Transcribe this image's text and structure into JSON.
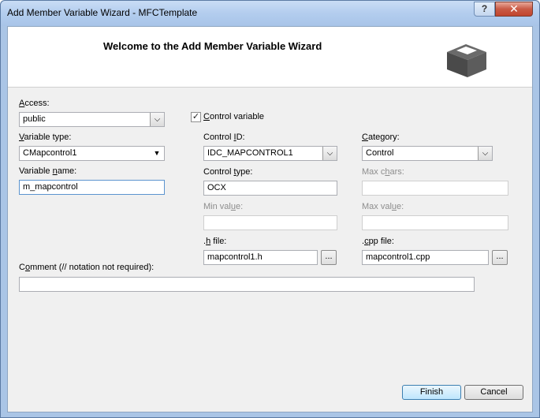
{
  "window": {
    "title": "Add Member Variable Wizard - MFCTemplate",
    "help_label": "?",
    "close_label": "✕"
  },
  "banner": {
    "title": "Welcome to the Add Member Variable Wizard",
    "icon": "box-icon"
  },
  "form": {
    "access": {
      "label_key": "A",
      "label_rest": "ccess:",
      "value": "public"
    },
    "control_variable": {
      "label_key": "C",
      "label_rest": "ontrol variable",
      "checked": true,
      "check_glyph": "✓"
    },
    "variable_type": {
      "label_pre": "",
      "label_key": "V",
      "label_rest": "ariable type:",
      "value": "CMapcontrol1"
    },
    "variable_name": {
      "label_pre": "Variable ",
      "label_key": "n",
      "label_rest": "ame:",
      "value": "m_mapcontrol"
    },
    "control_id": {
      "label_pre": "Control ",
      "label_key": "I",
      "label_rest": "D:",
      "value": "IDC_MAPCONTROL1"
    },
    "category": {
      "label_key": "C",
      "label_rest": "ategory:",
      "value": "Control"
    },
    "control_type": {
      "label_pre": "Control ",
      "label_key": "t",
      "label_rest": "ype:",
      "value": "OCX"
    },
    "max_chars": {
      "label_pre": "Max c",
      "label_key": "h",
      "label_rest": "ars:",
      "value": ""
    },
    "min_value": {
      "label_pre": "Min val",
      "label_key": "u",
      "label_rest": "e:",
      "value": ""
    },
    "max_value": {
      "label_pre": "Max val",
      "label_key": "u",
      "label_rest": "e:",
      "value": ""
    },
    "h_file": {
      "label_pre": ".",
      "label_key": "h",
      "label_rest": " file:",
      "value": "mapcontrol1.h",
      "browse": "..."
    },
    "cpp_file": {
      "label_pre": ".",
      "label_key": "c",
      "label_rest": "pp file:",
      "value": "mapcontrol1.cpp",
      "browse": "..."
    },
    "comment": {
      "label_pre": "C",
      "label_key": "o",
      "label_rest": "mment (// notation not required):",
      "value": ""
    }
  },
  "buttons": {
    "finish": "Finish",
    "cancel": "Cancel"
  },
  "icons": {
    "dropdown": "chevron-down-icon",
    "dropdown_glyph": "⌵",
    "arrow_glyph": "▼"
  }
}
